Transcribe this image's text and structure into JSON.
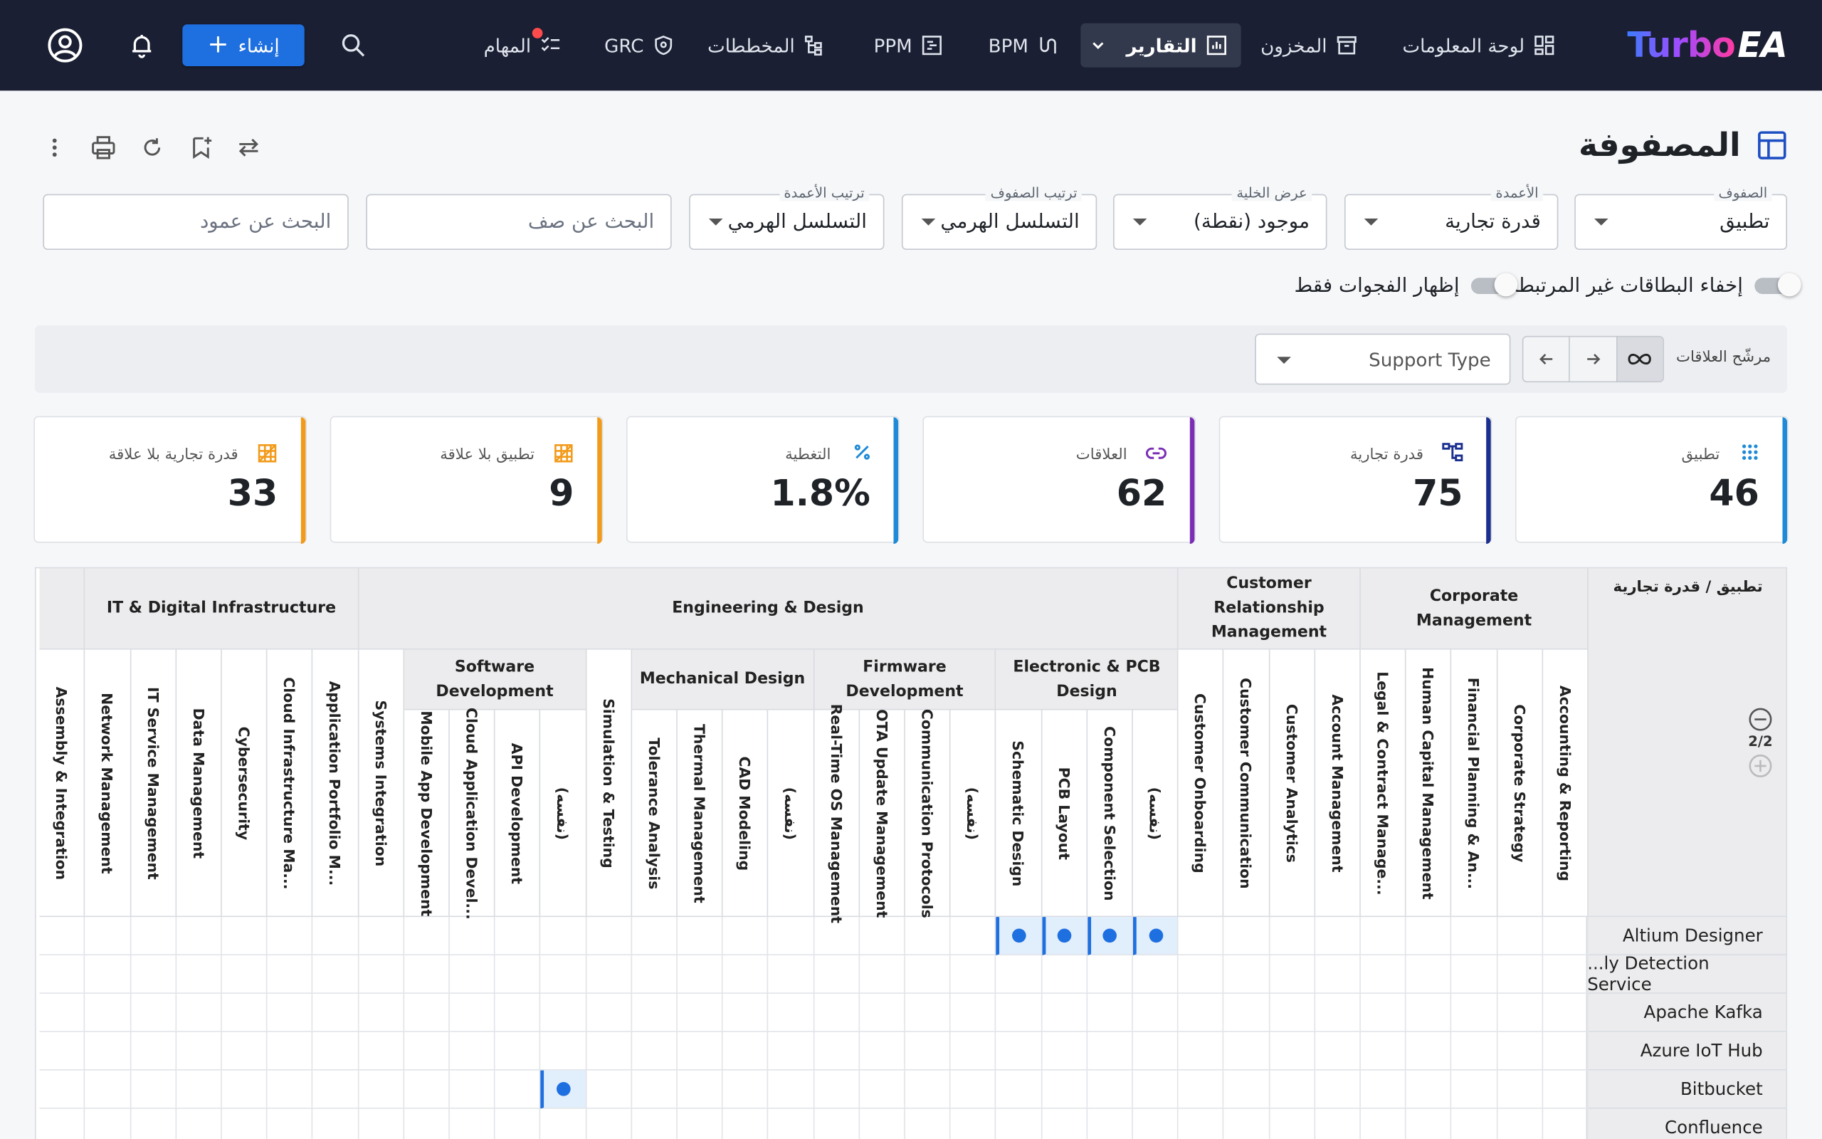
{
  "brand": {
    "logo_part1": "Turbo",
    "logo_part2": "EA"
  },
  "nav": {
    "dashboard": "لوحة المعلومات",
    "inventory": "المخزون",
    "reports": "التقارير",
    "bpm": "BPM",
    "ppm": "PPM",
    "diagrams": "المخططات",
    "grc": "GRC",
    "tasks": "المهام",
    "create": "إنشاء"
  },
  "page": {
    "title": "المصفوفة"
  },
  "filters": {
    "rows": {
      "label": "الصفوف",
      "value": "تطبيق"
    },
    "columns": {
      "label": "الأعمدة",
      "value": "قدرة تجارية"
    },
    "cell_display": {
      "label": "عرض الخلية",
      "value": "موجود (نقطة)"
    },
    "row_order": {
      "label": "ترتيب الصفوف",
      "value": "التسلسل الهرمي"
    },
    "col_order": {
      "label": "ترتيب الأعمدة",
      "value": "التسلسل الهرمي"
    },
    "row_search": {
      "placeholder": "البحث عن صف"
    },
    "col_search": {
      "placeholder": "البحث عن عمود"
    }
  },
  "toggles": {
    "hide_unlinked": "إخفاء البطاقات غير المرتبطة",
    "gaps_only": "إظهار الفجوات فقط"
  },
  "relation_filter": {
    "label": "مرشّح العلاقات",
    "type_placeholder": "Support Type"
  },
  "kpis": [
    {
      "label": "تطبيق",
      "value": "46",
      "color": "#1f8ad6",
      "icon": "grid-dots-icon"
    },
    {
      "label": "قدرة تجارية",
      "value": "75",
      "color": "#1b2f8f",
      "icon": "hierarchy-icon"
    },
    {
      "label": "العلاقات",
      "value": "62",
      "color": "#7b2fb5",
      "icon": "link-icon"
    },
    {
      "label": "التغطية",
      "value": "1.8%",
      "color": "#1f8ad6",
      "icon": "percent-icon"
    },
    {
      "label": "تطبيق بلا علاقة",
      "value": "9",
      "color": "#f29a1a",
      "icon": "unlinked-icon"
    },
    {
      "label": "قدرة تجارية بلا علاقة",
      "value": "33",
      "color": "#f29a1a",
      "icon": "unlinked-icon"
    }
  ],
  "matrix": {
    "corner_title": "تطبيق / قدرة تجارية",
    "level": "2/2",
    "groups": [
      {
        "name": "Corporate Management",
        "cols": 5
      },
      {
        "name": "Customer Relationship Management",
        "cols": 4
      },
      {
        "name": "Engineering & Design",
        "cols": 18
      },
      {
        "name": "IT & Digital Infrastructure",
        "cols": 6
      },
      {
        "name": "",
        "cols": 1
      }
    ],
    "subgroups": [
      {
        "name": "Electronic & PCB Design",
        "start": 9,
        "cols": 4
      },
      {
        "name": "Firmware Development",
        "start": 13,
        "cols": 4
      },
      {
        "name": "Mechanical Design",
        "start": 17,
        "cols": 4
      },
      {
        "name": "Software Development",
        "start": 22,
        "cols": 4
      }
    ],
    "columns": [
      "Accounting & Reporting",
      "Corporate Strategy",
      "Financial Planning & An...",
      "Human Capital Management",
      "Legal & Contract Manage...",
      "Account Management",
      "Customer Analytics",
      "Customer Communication",
      "Customer Onboarding",
      "(نفسه)",
      "Component Selection",
      "PCB Layout",
      "Schematic Design",
      "(نفسه)",
      "Communication Protocols",
      "OTA Update Management",
      "Real-Time OS Management",
      "(نفسه)",
      "CAD Modeling",
      "Thermal Management",
      "Tolerance Analysis",
      "Simulation & Testing",
      "(نفسه)",
      "API Development",
      "Cloud Application Devel...",
      "Mobile App Development",
      "Systems Integration",
      "Application Portfolio M...",
      "Cloud Infrastructure Ma...",
      "Cybersecurity",
      "Data Management",
      "IT Service Management",
      "Network Management",
      "Assembly & Integration"
    ],
    "rows": [
      {
        "name": "Altium Designer",
        "filled": [
          9,
          10,
          11,
          12
        ]
      },
      {
        "name": "...ly Detection Service",
        "filled": []
      },
      {
        "name": "Apache Kafka",
        "filled": []
      },
      {
        "name": "Azure IoT Hub",
        "filled": []
      },
      {
        "name": "Bitbucket",
        "filled": [
          22
        ]
      },
      {
        "name": "Confluence",
        "filled": []
      }
    ]
  }
}
